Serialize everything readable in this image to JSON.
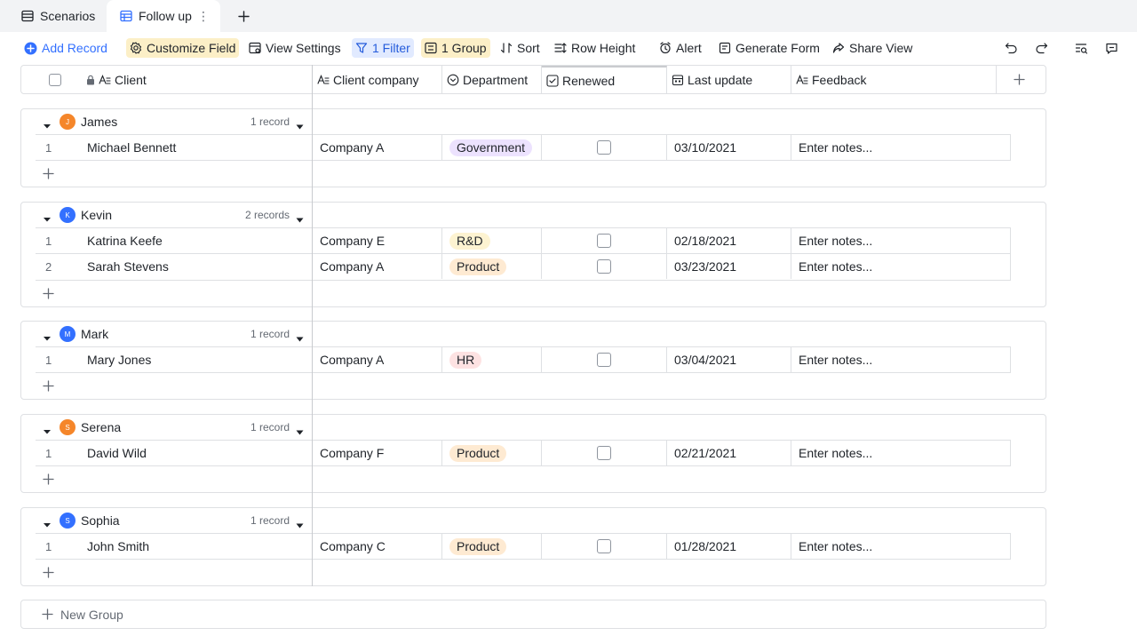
{
  "tabs": [
    {
      "label": "Scenarios",
      "icon": "table-icon"
    },
    {
      "label": "Follow up",
      "icon": "grid-view-icon",
      "active": true
    }
  ],
  "tab_more_glyph": "⋮",
  "toolbar": {
    "add_record": "Add Record",
    "customize_field": "Customize Field",
    "view_settings": "View Settings",
    "filter": "1 Filter",
    "group": "1 Group",
    "sort": "Sort",
    "row_height": "Row Height",
    "alert": "Alert",
    "generate_form": "Generate Form",
    "share_view": "Share View"
  },
  "columns": {
    "client": "Client",
    "client_company": "Client company",
    "department": "Department",
    "renewed": "Renewed",
    "last_update": "Last update",
    "feedback": "Feedback"
  },
  "groups": [
    {
      "name": "James",
      "initial": "J",
      "avatar_color": "#f5862a",
      "count": "1 record",
      "rows": [
        {
          "num": "1",
          "client": "Michael Bennett",
          "company": "Company A",
          "department": "Government",
          "tag": "government",
          "date": "03/10/2021",
          "feedback": "Enter notes..."
        }
      ]
    },
    {
      "name": "Kevin",
      "initial": "K",
      "avatar_color": "#3370ff",
      "count": "2 records",
      "rows": [
        {
          "num": "1",
          "client": "Katrina Keefe",
          "company": "Company E",
          "department": "R&D",
          "tag": "rd",
          "date": "02/18/2021",
          "feedback": "Enter notes..."
        },
        {
          "num": "2",
          "client": "Sarah Stevens",
          "company": "Company A",
          "department": "Product",
          "tag": "product",
          "date": "03/23/2021",
          "feedback": "Enter notes..."
        }
      ]
    },
    {
      "name": "Mark",
      "initial": "M",
      "avatar_color": "#3370ff",
      "count": "1 record",
      "rows": [
        {
          "num": "1",
          "client": "Mary Jones",
          "company": "Company A",
          "department": "HR",
          "tag": "hr",
          "date": "03/04/2021",
          "feedback": "Enter notes..."
        }
      ]
    },
    {
      "name": "Serena",
      "initial": "S",
      "avatar_color": "#f5862a",
      "count": "1 record",
      "rows": [
        {
          "num": "1",
          "client": "David Wild",
          "company": "Company F",
          "department": "Product",
          "tag": "product",
          "date": "02/21/2021",
          "feedback": "Enter notes..."
        }
      ]
    },
    {
      "name": "Sophia",
      "initial": "S",
      "avatar_color": "#3370ff",
      "count": "1 record",
      "rows": [
        {
          "num": "1",
          "client": "John Smith",
          "company": "Company C",
          "department": "Product",
          "tag": "product",
          "date": "01/28/2021",
          "feedback": "Enter notes..."
        }
      ]
    }
  ],
  "new_group": "New Group"
}
